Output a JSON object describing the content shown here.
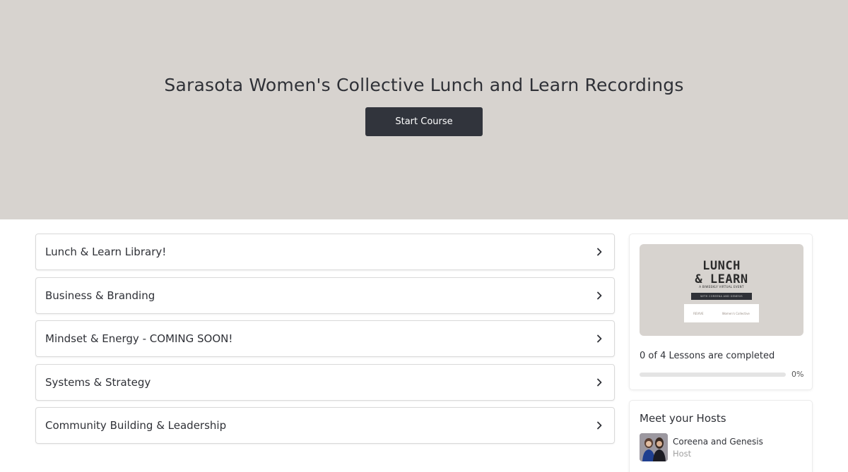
{
  "hero": {
    "title": "Sarasota Women's Collective Lunch and Learn Recordings",
    "start_button": "Start Course",
    "background_color": "#d7d3cf",
    "button_color": "#31343c"
  },
  "modules": [
    {
      "label": "Lunch & Learn Library!",
      "icon": "chevron-right-icon"
    },
    {
      "label": "Business & Branding",
      "icon": "chevron-right-icon"
    },
    {
      "label": "Mindset & Energy - COMING SOON!",
      "icon": "chevron-right-icon"
    },
    {
      "label": "Systems & Strategy",
      "icon": "chevron-right-icon"
    },
    {
      "label": "Community Building & Leadership",
      "icon": "chevron-right-icon"
    }
  ],
  "course_card": {
    "thumbnail": {
      "title_line1": "LUNCH",
      "title_line2": "& LEARN",
      "subtitle": "A BIWEEKLY VIRTUAL EVENT",
      "bar_text": "WITH COREENA AND GENESIS",
      "logo_left": "REVIVE",
      "logo_right": "Women's Collective"
    },
    "progress_text": "0 of 4 Lessons are completed",
    "progress_percent_label": "0%",
    "progress_fraction": 0
  },
  "hosts": {
    "title": "Meet your Hosts",
    "items": [
      {
        "name": "Coreena and Genesis",
        "role": "Host"
      }
    ]
  }
}
